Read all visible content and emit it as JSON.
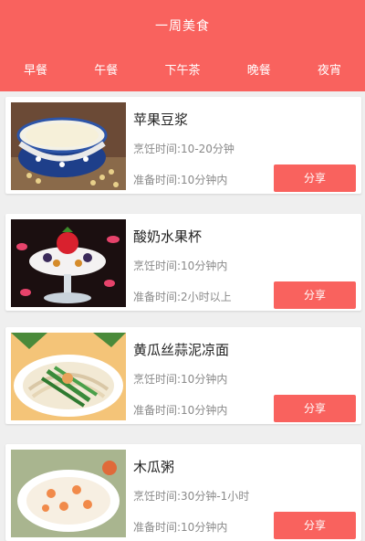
{
  "header": {
    "title": "一周美食",
    "tabs": [
      "早餐",
      "午餐",
      "下午茶",
      "晚餐",
      "夜宵"
    ]
  },
  "items": [
    {
      "name": "苹果豆浆",
      "cook_time": "烹饪时间:10-20分钟",
      "prep_time": "准备时间:10分钟内",
      "share_label": "分享",
      "image": "soy-milk-photo"
    },
    {
      "name": "酸奶水果杯",
      "cook_time": "烹饪时间:10分钟内",
      "prep_time": "准备时间:2小时以上",
      "share_label": "分享",
      "image": "yogurt-fruit-cup-photo"
    },
    {
      "name": "黄瓜丝蒜泥凉面",
      "cook_time": "烹饪时间:10分钟内",
      "prep_time": "准备时间:10分钟内",
      "share_label": "分享",
      "image": "cold-noodles-photo"
    },
    {
      "name": "木瓜粥",
      "cook_time": "烹饪时间:30分钟-1小时",
      "prep_time": "准备时间:10分钟内",
      "share_label": "分享",
      "image": "papaya-porridge-photo"
    }
  ],
  "colors": {
    "accent": "#f9625e",
    "background": "#efefef"
  }
}
